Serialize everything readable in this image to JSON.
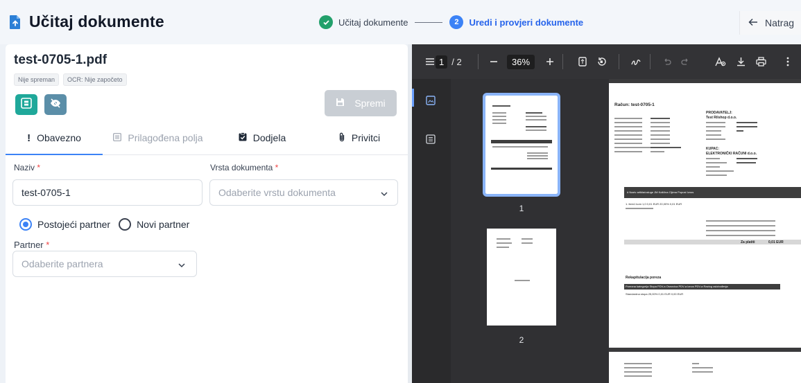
{
  "header": {
    "title": "Učitaj dokumente",
    "steps": [
      {
        "number": "1",
        "label": "Učitaj dokumente",
        "status": "done"
      },
      {
        "number": "2",
        "label": "Uredi i provjeri dokumente",
        "status": "active"
      }
    ],
    "back_label": "Natrag"
  },
  "document": {
    "file_name": "test-0705-1.pdf",
    "badges": [
      "Nije spreman",
      "OCR: Nije započeto"
    ],
    "save_label": "Spremi"
  },
  "tabs": [
    {
      "label": "Obavezno",
      "active": true
    },
    {
      "label": "Prilagođena polja",
      "active": false
    },
    {
      "label": "Dodjela",
      "active": false
    },
    {
      "label": "Privitci",
      "active": false
    }
  ],
  "form": {
    "naziv_label": "Naziv",
    "naziv_value": "test-0705-1",
    "vrsta_label": "Vrsta dokumenta",
    "vrsta_placeholder": "Odaberite vrstu dokumenta",
    "partner_option_existing": "Postojeći partner",
    "partner_option_new": "Novi partner",
    "partner_label": "Partner",
    "partner_placeholder": "Odaberite partnera",
    "required_mark": "*"
  },
  "viewer": {
    "current_page": "1",
    "page_total": "/ 2",
    "zoom": "36%",
    "thumbnail_labels": [
      "1",
      "2"
    ],
    "page_text": {
      "title": "Račun: test-0705-1",
      "seller_heading": "PRODAVATELJ:",
      "seller_name": "Test Rilshop d.o.o.",
      "buyer_heading": "KUPAC:",
      "buyer_name": "ELEKTRONIČKI RAČUNI d.o.o.",
      "table_header": "#   Naziv artikla/usluge        JM   Količina   Cijena   Popust   Iznos",
      "item_row": "1.  item1        kom   1,0   0,01 EUR   20,00%   0,01 EUR",
      "totals_label": "Za platiti",
      "totals_value": "0,01 EUR",
      "recap_heading": "Rekapitulacija poreza",
      "recap_header": "Porezna kategorija   Stopa PDV-a   Osnovica PDV-a   Iznos PDV-a   Razlog oslobođenja",
      "recap_row": "Standardna stopa   25,00%   0,01 EUR   0,00 EUR"
    }
  },
  "colors": {
    "accent": "#3b82f6",
    "success": "#22a06b",
    "teal_button": "#1fa89a",
    "slate_button": "#5b8ea8",
    "viewer_bg": "#2f2f31"
  },
  "icons": {
    "title": "document-upload-icon",
    "back": "arrow-left-icon",
    "save": "floppy-disk-icon",
    "ocr": "scan-icon",
    "hide": "eye-off-icon"
  }
}
